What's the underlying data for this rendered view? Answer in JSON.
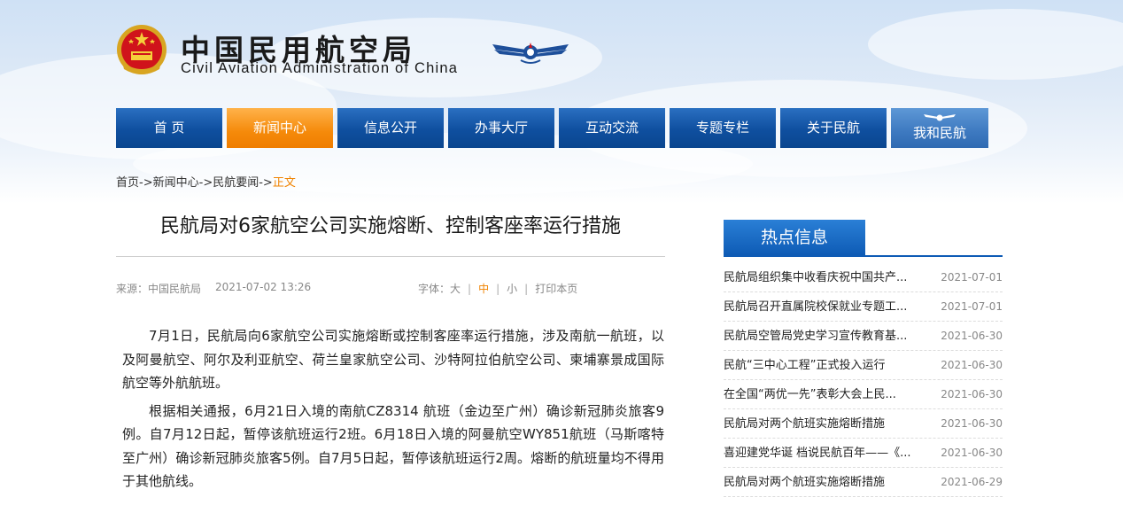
{
  "site": {
    "name_cn": "中国民用航空局",
    "name_en": "Civil Aviation Administration of China"
  },
  "nav": {
    "items": [
      {
        "label": "首 页"
      },
      {
        "label": "新闻中心"
      },
      {
        "label": "信息公开"
      },
      {
        "label": "办事大厅"
      },
      {
        "label": "互动交流"
      },
      {
        "label": "专题专栏"
      },
      {
        "label": "关于民航"
      },
      {
        "label": "我和民航"
      }
    ],
    "active_index": 1
  },
  "breadcrumb": {
    "home": "首页",
    "news": "新闻中心",
    "minhang": "民航要闻",
    "sep": "->",
    "current": "正文"
  },
  "article": {
    "title": "民航局对6家航空公司实施熔断、控制客座率运行措施",
    "source": "来源：中国民航局",
    "date": "2021-07-02 13:26",
    "font_label": "字体：",
    "font_large": "大",
    "font_medium": "中",
    "font_small": "小",
    "print": "打印本页",
    "paragraphs": [
      "7月1日，民航局向6家航空公司实施熔断或控制客座率运行措施，涉及南航一航班，以及阿曼航空、阿尔及利亚航空、荷兰皇家航空公司、沙特阿拉伯航空公司、柬埔寨景成国际航空等外航航班。",
      "根据相关通报，6月21日入境的南航CZ8314 航班（金边至广州）确诊新冠肺炎旅客9例。自7月12日起，暂停该航班运行2班。6月18日入境的阿曼航空WY851航班（马斯喀特至广州）确诊新冠肺炎旅客5例。自7月5日起，暂停该航班运行2周。熔断的航班量均不得用于其他航线。"
    ]
  },
  "hot": {
    "title": "热点信息",
    "items": [
      {
        "title": "民航局组织集中收看庆祝中国共产...",
        "date": "2021-07-01"
      },
      {
        "title": "民航局召开直属院校保就业专题工...",
        "date": "2021-07-01"
      },
      {
        "title": "民航局空管局党史学习宣传教育基...",
        "date": "2021-06-30"
      },
      {
        "title": "民航“三中心工程”正式投入运行",
        "date": "2021-06-30"
      },
      {
        "title": "在全国“两优一先”表彰大会上民...",
        "date": "2021-06-30"
      },
      {
        "title": "民航局对两个航班实施熔断措施",
        "date": "2021-06-30"
      },
      {
        "title": "喜迎建党华诞 档说民航百年——《...",
        "date": "2021-06-30"
      },
      {
        "title": "民航局对两个航班实施熔断措施",
        "date": "2021-06-29"
      }
    ]
  },
  "colors": {
    "nav_blue": "#0f4f9f",
    "nav_active": "#f58a0a",
    "accent_orange": "#f08300",
    "hot_blue": "#0e5bb5"
  }
}
